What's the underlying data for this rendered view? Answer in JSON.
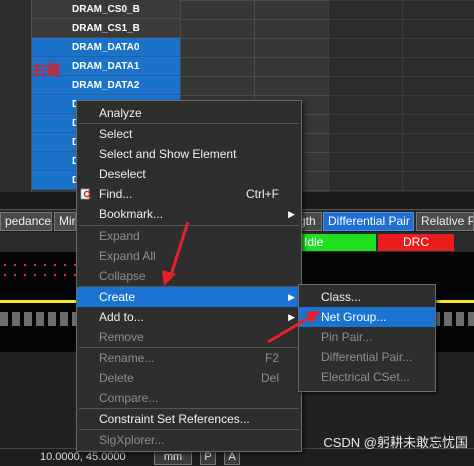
{
  "nets": [
    "DRAM_CS0_B",
    "DRAM_CS1_B",
    "DRAM_DATA0",
    "DRAM_DATA1",
    "DRAM_DATA2"
  ],
  "nets_partial": [
    "D",
    "D",
    "D",
    "D",
    "D"
  ],
  "annotation_text": "右键",
  "tabs": [
    "pedance",
    "Min",
    "gth",
    "Differential Pair",
    "Relative Pr"
  ],
  "status": {
    "idle": "Idle",
    "drc": "DRC"
  },
  "colors": {
    "selection": "#1a73c9",
    "idle": "#21e021",
    "drc": "#e81e1e",
    "arrow": "#e8202a"
  },
  "context_menu": {
    "analyze": "Analyze",
    "select": "Select",
    "select_show": "Select and Show Element",
    "deselect": "Deselect",
    "find": "Find...",
    "find_shortcut": "Ctrl+F",
    "bookmark": "Bookmark...",
    "expand": "Expand",
    "expand_all": "Expand All",
    "collapse": "Collapse",
    "create": "Create",
    "add_to": "Add to...",
    "remove": "Remove",
    "rename": "Rename...",
    "rename_shortcut": "F2",
    "delete": "Delete",
    "delete_shortcut": "Del",
    "compare": "Compare...",
    "constraint_refs": "Constraint Set References...",
    "sigxplorer": "SigXplorer..."
  },
  "create_submenu": {
    "class": "Class...",
    "net_group": "Net Group...",
    "pin_pair": "Pin Pair...",
    "diff_pair": "Differential Pair...",
    "electrical_cset": "Electrical CSet..."
  },
  "statusbar": {
    "coords": "10.0000, 45.0000",
    "units": "mm",
    "p": "P",
    "a": "A"
  },
  "watermark": "CSDN @躬耕未敢忘忧国"
}
